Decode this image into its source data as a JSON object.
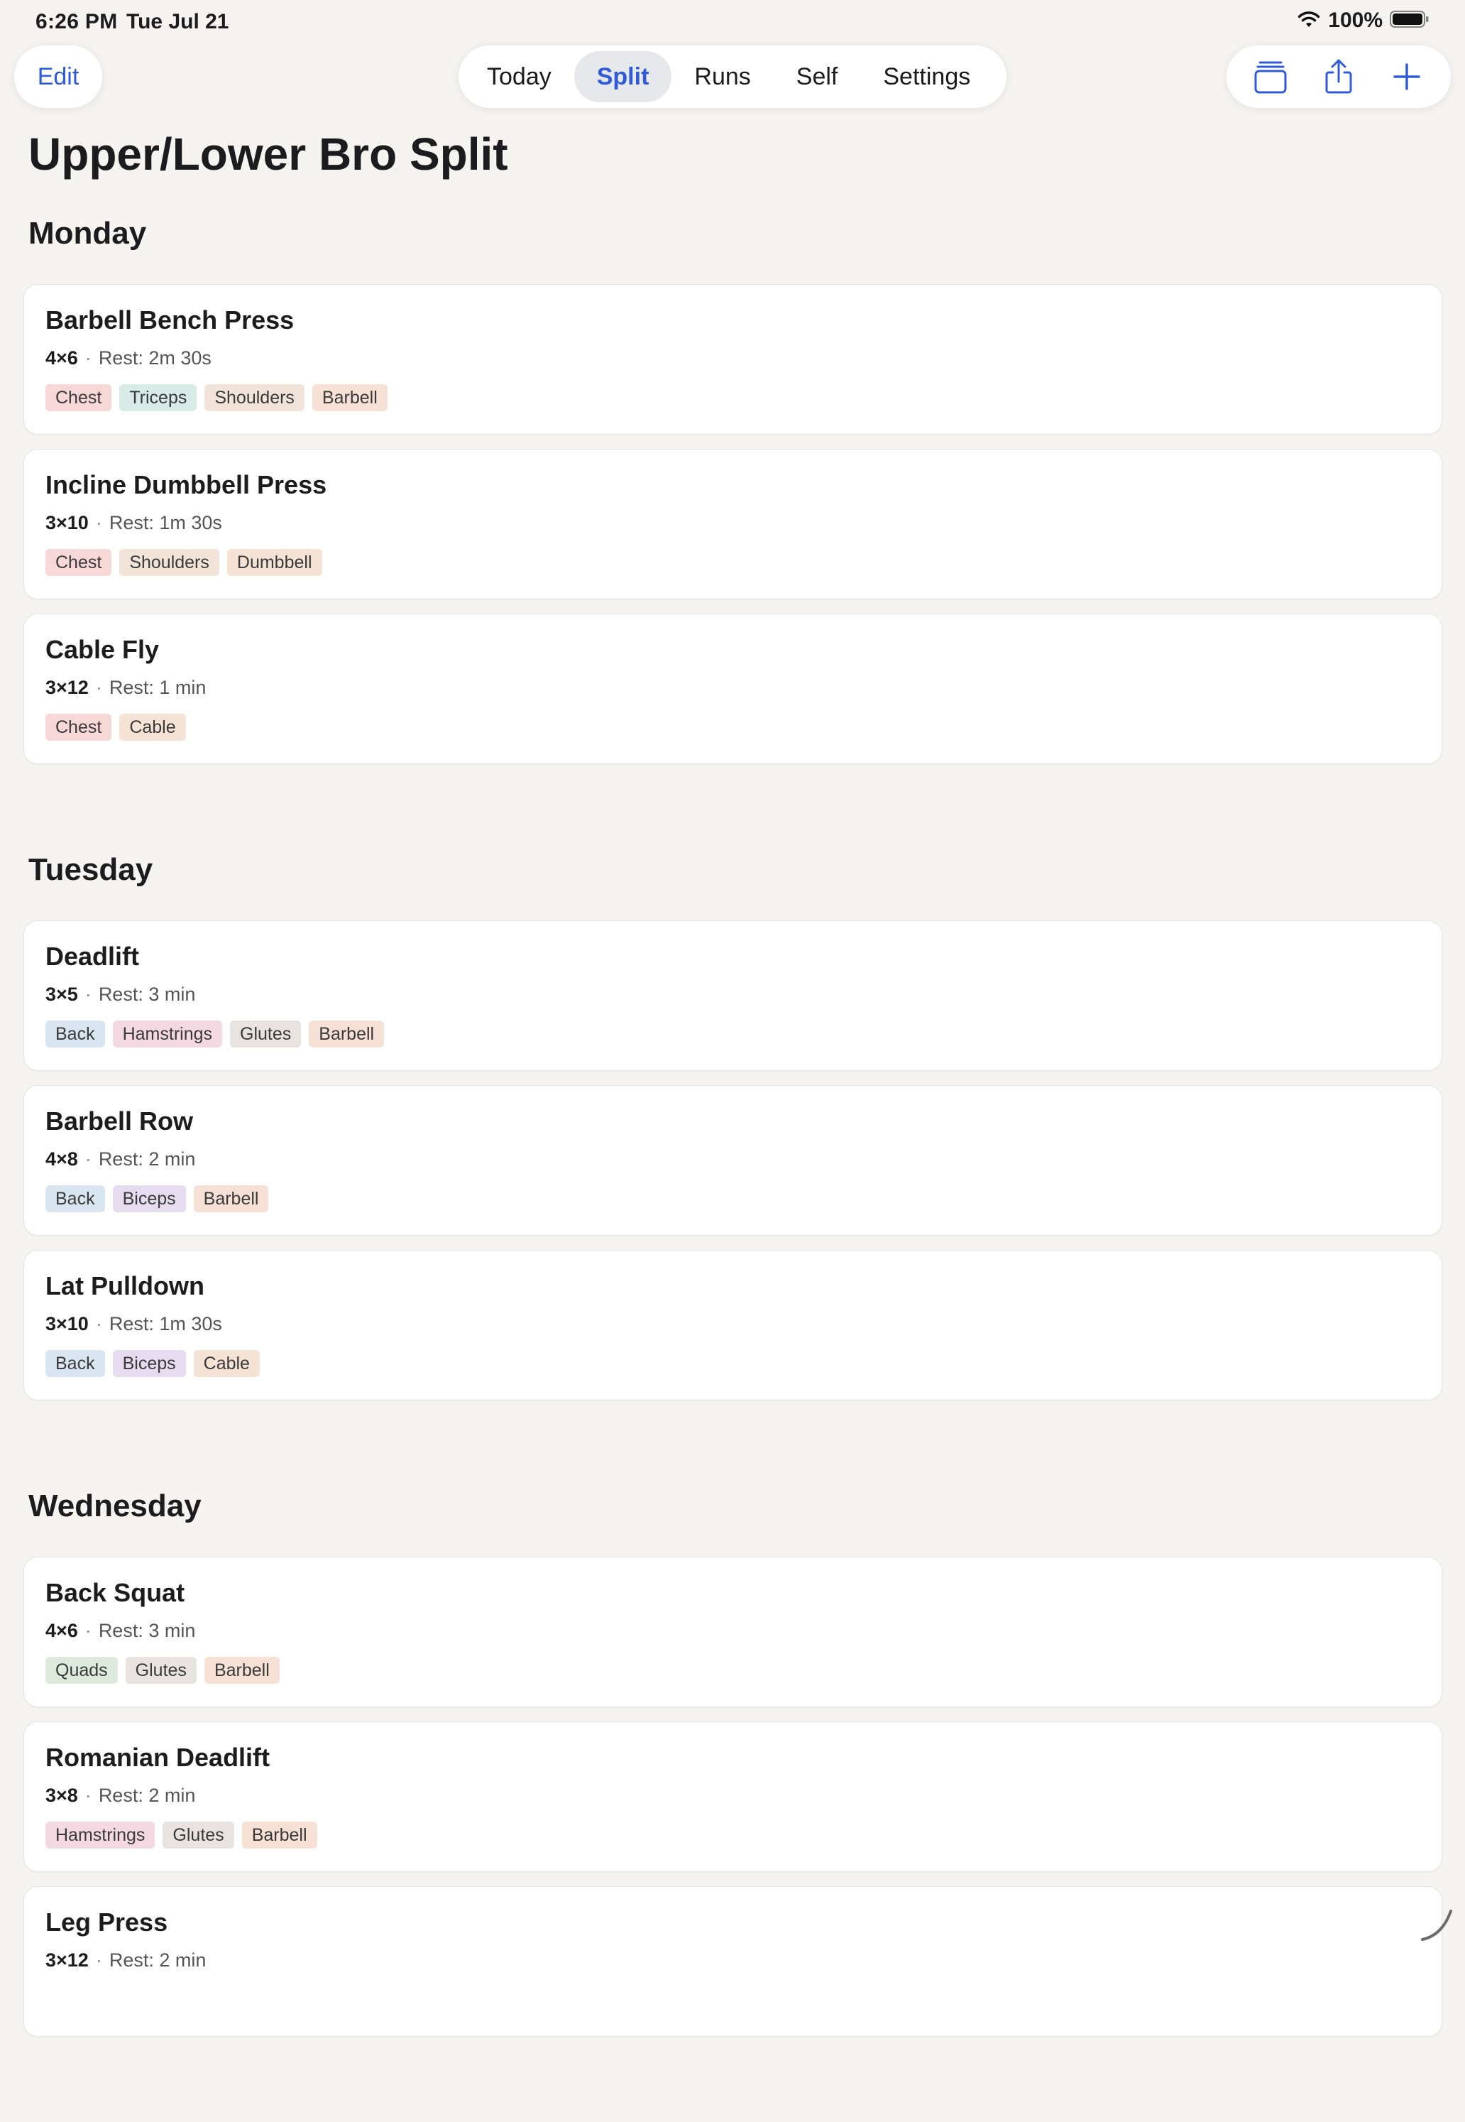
{
  "status": {
    "time": "6:26 PM",
    "date": "Tue Jul 21",
    "battery": "100%"
  },
  "nav": {
    "edit_label": "Edit",
    "tabs": [
      {
        "label": "Today",
        "active": false
      },
      {
        "label": "Split",
        "active": true
      },
      {
        "label": "Runs",
        "active": false
      },
      {
        "label": "Self",
        "active": false
      },
      {
        "label": "Settings",
        "active": false
      }
    ],
    "actions": [
      "stack-icon",
      "share-icon",
      "plus-icon"
    ]
  },
  "title": "Upper/Lower Bro Split",
  "days": [
    {
      "name": "Monday",
      "exercises": [
        {
          "name": "Barbell Bench Press",
          "sets": "4×6",
          "rest": "Rest: 2m 30s",
          "tags": [
            "Chest",
            "Triceps",
            "Shoulders",
            "Barbell"
          ]
        },
        {
          "name": "Incline Dumbbell Press",
          "sets": "3×10",
          "rest": "Rest: 1m 30s",
          "tags": [
            "Chest",
            "Shoulders",
            "Dumbbell"
          ]
        },
        {
          "name": "Cable Fly",
          "sets": "3×12",
          "rest": "Rest: 1 min",
          "tags": [
            "Chest",
            "Cable"
          ]
        }
      ]
    },
    {
      "name": "Tuesday",
      "exercises": [
        {
          "name": "Deadlift",
          "sets": "3×5",
          "rest": "Rest: 3 min",
          "tags": [
            "Back",
            "Hamstrings",
            "Glutes",
            "Barbell"
          ]
        },
        {
          "name": "Barbell Row",
          "sets": "4×8",
          "rest": "Rest: 2 min",
          "tags": [
            "Back",
            "Biceps",
            "Barbell"
          ]
        },
        {
          "name": "Lat Pulldown",
          "sets": "3×10",
          "rest": "Rest: 1m 30s",
          "tags": [
            "Back",
            "Biceps",
            "Cable"
          ]
        }
      ]
    },
    {
      "name": "Wednesday",
      "exercises": [
        {
          "name": "Back Squat",
          "sets": "4×6",
          "rest": "Rest: 3 min",
          "tags": [
            "Quads",
            "Glutes",
            "Barbell"
          ]
        },
        {
          "name": "Romanian Deadlift",
          "sets": "3×8",
          "rest": "Rest: 2 min",
          "tags": [
            "Hamstrings",
            "Glutes",
            "Barbell"
          ]
        },
        {
          "name": "Leg Press",
          "sets": "3×12",
          "rest": "Rest: 2 min",
          "tags": []
        }
      ]
    }
  ],
  "colors": {
    "accent": "#2f5bd8",
    "background": "#f5f4f0",
    "tag_chest": "#f7d8d6",
    "tag_triceps": "#d8ebe7",
    "tag_shoulders": "#f2e4d8",
    "tag_back": "#d9e6f2",
    "tag_hamstrings": "#f4d9e2",
    "tag_biceps": "#e5dcf0",
    "tag_quads": "#dceadb"
  }
}
